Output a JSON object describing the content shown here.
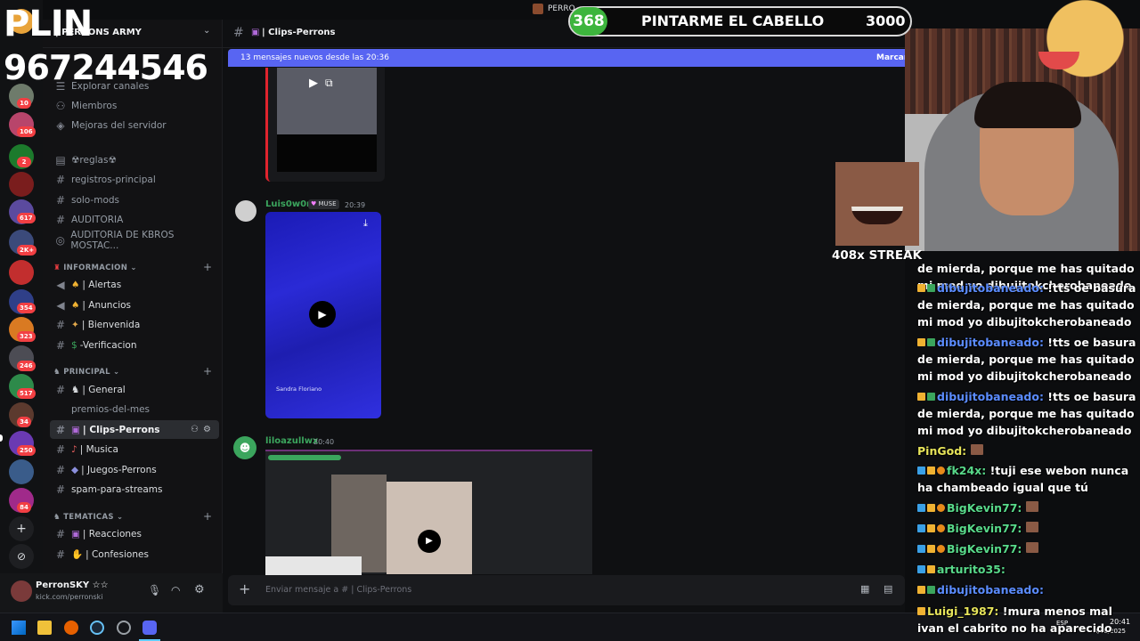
{
  "overlay": {
    "plin": "PLIN",
    "phone": "967244546",
    "goal": {
      "count": "368",
      "label": "PINTARME EL CABELLO",
      "target": "3000"
    },
    "streak": "408x STREAK"
  },
  "window": {
    "title": "PERRO"
  },
  "server": {
    "name": "| PERRONS ARMY"
  },
  "rail_badges": [
    "10",
    "106",
    "2",
    "617",
    "2K+",
    "354",
    "323",
    "246",
    "517",
    "34",
    "250",
    "84"
  ],
  "sidebar": {
    "top_items": [
      {
        "label": "Explorar canales"
      },
      {
        "label": "Miembros"
      },
      {
        "label": "Mejoras del servidor"
      }
    ],
    "channels_a": [
      {
        "label": "☢reglas☢"
      },
      {
        "label": "registros-principal"
      },
      {
        "label": "solo-mods"
      },
      {
        "label": "AUDITORIA"
      },
      {
        "label": "AUDITORIA DE KBROS MOSTAC..."
      }
    ],
    "cat_info": "INFORMACION",
    "channels_info": [
      {
        "label": "| Alertas"
      },
      {
        "label": "| Anuncios"
      },
      {
        "label": "| Bienvenida"
      },
      {
        "label": "-Verificacion"
      }
    ],
    "cat_principal": "PRINCIPAL",
    "channels_principal": [
      {
        "label": "| General"
      },
      {
        "label": "premios-del-mes"
      },
      {
        "label": "| Clips-Perrons"
      },
      {
        "label": "| Musica"
      },
      {
        "label": "| Juegos-Perrons"
      },
      {
        "label": "spam-para-streams"
      }
    ],
    "cat_tematicas": "TEMATICAS",
    "channels_tematicas": [
      {
        "label": "| Reacciones"
      },
      {
        "label": "| Confesiones"
      }
    ]
  },
  "user": {
    "name": "PerronSKY ☆☆",
    "status": "kick.com/perronski"
  },
  "chat": {
    "channel": "| Clips-Perrons",
    "new_bar": "13 mensajes nuevos desde las 20:36",
    "mark": "Marcar",
    "msg1": {
      "author": "Luis0w0r",
      "role": "MUSE",
      "time": "20:39",
      "caption": "Sandra Floriano"
    },
    "msg2": {
      "author": "liloazullwx",
      "time": "20:40"
    },
    "composer_placeholder": "Enviar mensaje a # | Clips-Perrons"
  },
  "stream_chat": [
    {
      "name": "",
      "text": "de mierda, porque me has quitado mi mod yo dibujitokcherobaneado",
      "color": "#ffffff"
    },
    {
      "name": "dibujitobaneado:",
      "text": " !tts oe basura de mierda, porque me has quitado mi mod yo dibujitokcherobaneado",
      "color": "#5b8cff"
    },
    {
      "name": "dibujitobaneado:",
      "text": " !tts oe basura de mierda, porque me has quitado mi mod yo dibujitokcherobaneado",
      "color": "#5b8cff"
    },
    {
      "name": "dibujitobaneado:",
      "text": " !tts oe basura de mierda, porque me has quitado mi mod yo dibujitokcherobaneado",
      "color": "#5b8cff"
    },
    {
      "name": "PinGod:",
      "text": "",
      "color": "#e7e45a"
    },
    {
      "name": "fk24x:",
      "text": " !tuji ese webon nunca ha chambeado igual que tú",
      "color": "#58d98a"
    },
    {
      "name": "BigKevin77:",
      "text": "",
      "color": "#58d98a"
    },
    {
      "name": "BigKevin77:",
      "text": "",
      "color": "#58d98a"
    },
    {
      "name": "BigKevin77:",
      "text": "",
      "color": "#58d98a"
    },
    {
      "name": "arturito35:",
      "text": "",
      "color": "#58d98a"
    },
    {
      "name": "dibujitobaneado:",
      "text": "",
      "color": "#5b8cff"
    },
    {
      "name": "Luigi_1987:",
      "text": " !mura menos mal ivan el cabrito no ha aparecido",
      "color": "#e7e45a"
    }
  ],
  "taskbar": {
    "lang": "ESP",
    "time": "20:41",
    "date": "8/10/2025"
  },
  "colors": {
    "accent": "#5865f2",
    "goal_green": "#3db53d",
    "mention": "#f23f43"
  }
}
